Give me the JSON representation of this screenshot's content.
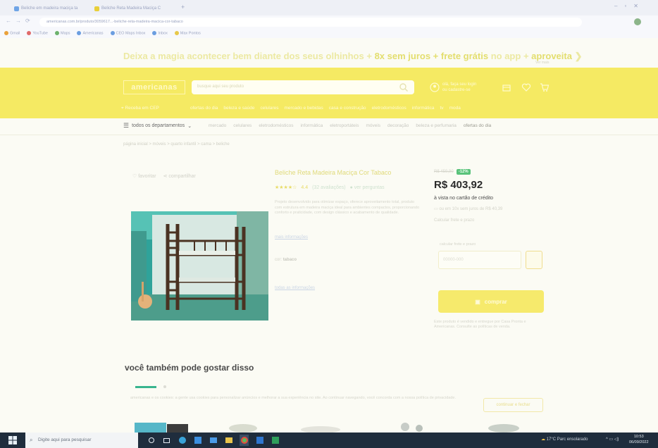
{
  "browser": {
    "tabs": [
      {
        "label": "Beliche em madeira maciça ta"
      },
      {
        "label": "Beliche Reta Madeira Maciça C"
      }
    ],
    "url": "americanas.com.br/produto/3059617...-beliche-reta-madeira-macica-cor-tabaco",
    "bookmarks": [
      "Gmail",
      "YouTube",
      "Maps",
      "Americanas",
      "CEO Maps Inbox",
      "Inbox",
      "Max Pontos"
    ]
  },
  "promo": {
    "part1": "Deixa a magia acontecer bem diante dos seus olhinhos",
    "part2": "8x sem juros + frete grátis",
    "part3": "no app",
    "part4": "aproveita",
    "small": "Ver mais"
  },
  "header": {
    "logo": "americanas",
    "search_placeholder": "busque aqui seu produto",
    "account_line1": "olá, faça seu login",
    "account_line2": "ou cadastre-se",
    "cep": "Receba em CEP",
    "nav": [
      "ofertas do dia",
      "beleza e saúde",
      "celulares",
      "mercado e bebidas",
      "casa e construção",
      "eletrodomésticos",
      "informática",
      "tv",
      "moda"
    ]
  },
  "dept": {
    "label": "todos os departamentos",
    "links": [
      "mercado",
      "celulares",
      "eletrodomésticos",
      "informática",
      "eletroportáteis",
      "móveis",
      "decoração",
      "beleza e perfumaria",
      "ofertas do dia"
    ]
  },
  "breadcrumb": "página inicial > móveis > quarto infantil > cama > beliche",
  "product": {
    "fav_label": "favoritar",
    "share_label": "compartilhar",
    "title": "Beliche Reta Madeira Maciça Cor Tabaco",
    "rating_value": "4.4",
    "reviews": "(32 avaliações)",
    "questions": "ver perguntas",
    "description": "Projeto desenvolvido para otimizar espaço, oferece aproveitamento total, produto com estrutura em madeira maciça ideal para ambientes compactos, proporcionando conforto e praticidade, com design clássico e acabamento de qualidade.",
    "more_info": "mais informações",
    "color_label": "cor:",
    "color_value": "tabaco",
    "all_info": "todas as informações"
  },
  "pricing": {
    "old_price": "R$ 459,90",
    "discount": "-12%",
    "price": "R$ 403,92",
    "price_note": "à vista no cartão de crédito",
    "installments": "ou em 10x sem juros de R$ 40,39",
    "shipping_label": "Calcular frete e prazo",
    "cep_label": "calcular frete e prazo",
    "cep_placeholder": "00000-000",
    "buy_label": "comprar",
    "seller_note": "Este produto é vendido e entregue por Casa Pronta e Americanas. Consulte as políticas de venda."
  },
  "recommendations": {
    "title": "você também pode gostar disso"
  },
  "cookies": {
    "text": "americanas e os cookies: a gente usa cookies para personalizar anúncios e melhorar a sua experiência no site. Ao continuar navegando, você concorda com a nossa política de privacidade.",
    "button": "continuar e fechar"
  },
  "taskbar": {
    "search_placeholder": "Digite aqui para pesquisar",
    "weather": "17°C Parc ensolarado",
    "time": "10:53",
    "date": "06/09/2022"
  },
  "colors": {
    "brand_yellow": "#f5ea63",
    "price_text": "#2a2a2a",
    "discount_green": "#59c27a",
    "taskbar": "#1f2d3d"
  }
}
